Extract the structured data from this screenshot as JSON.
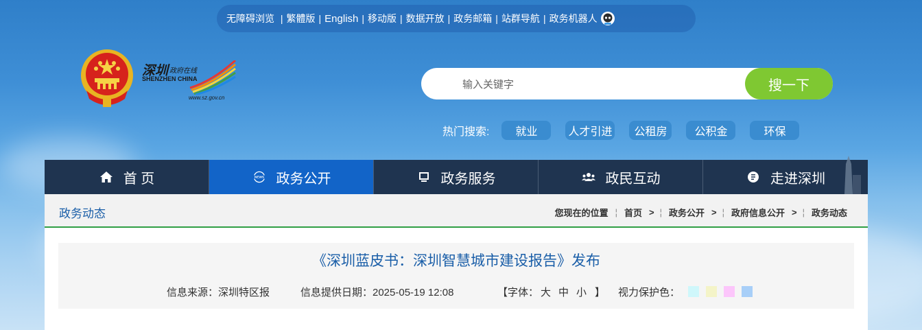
{
  "topbar": {
    "links": [
      "无障碍浏览",
      "繁體版",
      "English",
      "移动版",
      "数据开放",
      "政务邮箱",
      "站群导航",
      "政务机器人"
    ],
    "robot_icon": "robot-icon"
  },
  "logo": {
    "title_cn": "深圳",
    "subtitle_cn": "政府在线",
    "title_en": "SHENZHEN CHINA",
    "url": "www.sz.gov.cn"
  },
  "search": {
    "placeholder": "输入关键字",
    "button": "搜一下"
  },
  "hot": {
    "label": "热门搜索:",
    "tags": [
      "就业",
      "人才引进",
      "公租房",
      "公积金",
      "环保"
    ]
  },
  "nav": [
    {
      "label": "首 页",
      "icon": "home-icon"
    },
    {
      "label": "政务公开",
      "icon": "news-icon"
    },
    {
      "label": "政务服务",
      "icon": "monitor-icon"
    },
    {
      "label": "政民互动",
      "icon": "users-icon"
    },
    {
      "label": "走进深圳",
      "icon": "info-icon"
    }
  ],
  "section_title": "政务动态",
  "breadcrumb": {
    "prefix": "您现在的位置",
    "items": [
      "首页",
      "政务公开",
      "政府信息公开",
      "政务动态"
    ]
  },
  "article": {
    "title": "《深圳蓝皮书：深圳智慧城市建设报告》发布",
    "source": "信息来源：深圳特区报",
    "date": "信息提供日期：2025-05-19 12:08",
    "font_label": "【字体：",
    "font_sizes": [
      "大",
      "中",
      "小"
    ],
    "font_close": "】",
    "eye_label": "视力保护色：",
    "eye_colors": [
      "#cff7fb",
      "#f4f4c8",
      "#fcc6fb",
      "#a8cff8"
    ]
  }
}
